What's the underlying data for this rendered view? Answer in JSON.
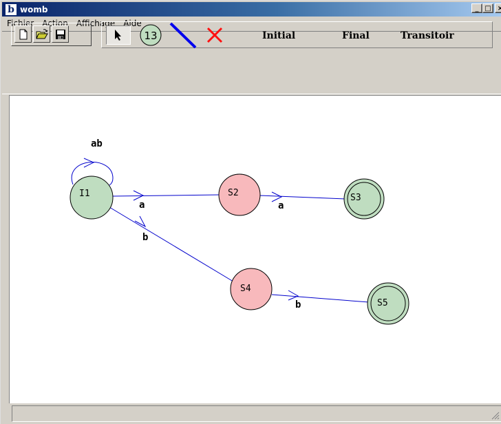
{
  "window": {
    "title": "womb",
    "app_icon": "b",
    "controls": {
      "minimize": "_",
      "maximize": "□",
      "close": "×"
    }
  },
  "menu": [
    "Fichier",
    "Action",
    "Affichage",
    "Aide"
  ],
  "toolbar": {
    "file_buttons": [
      "new-file-icon",
      "open-folder-icon",
      "save-disk-icon"
    ],
    "tools": {
      "select": "arrow-pointer-icon",
      "state_badge": "13",
      "transition": "blue-line-icon",
      "delete": "red-x-icon"
    },
    "state_types": [
      "Initial",
      "Final",
      "Transitoir"
    ]
  },
  "diagram": {
    "colors": {
      "initial_state": "#bfddc0",
      "transitory_state": "#f8b9bc",
      "final_state": "#bfddc0",
      "edge": "#0000cc",
      "label": "#000000"
    },
    "states": [
      {
        "id": "I1",
        "kind": "initial"
      },
      {
        "id": "S2",
        "kind": "transitory"
      },
      {
        "id": "S3",
        "kind": "final"
      },
      {
        "id": "S4",
        "kind": "transitory"
      },
      {
        "id": "S5",
        "kind": "final"
      }
    ],
    "transitions": [
      {
        "from": "I1",
        "to": "I1",
        "label": "ab"
      },
      {
        "from": "I1",
        "to": "S2",
        "label": "a"
      },
      {
        "from": "S2",
        "to": "S3",
        "label": "a"
      },
      {
        "from": "I1",
        "to": "S4",
        "label": "b"
      },
      {
        "from": "S4",
        "to": "S5",
        "label": "b"
      }
    ]
  },
  "status": {
    "text": ""
  }
}
